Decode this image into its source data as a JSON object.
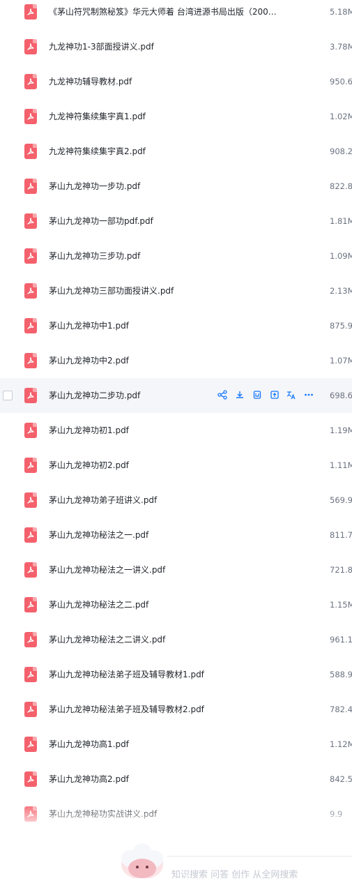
{
  "files": [
    {
      "name": "《茅山符咒制煞秘笈》华元大师着 台湾进源书局出版（200…",
      "size": "5.18M"
    },
    {
      "name": "九龙神功1-3部面授讲义.pdf",
      "size": "3.78M"
    },
    {
      "name": "九龙神功辅导教材.pdf",
      "size": "950.6"
    },
    {
      "name": "九龙神符集续集宇真1.pdf",
      "size": "1.02M"
    },
    {
      "name": "九龙神符集续集宇真2.pdf",
      "size": "908.2"
    },
    {
      "name": "茅山九龙神功一步功.pdf",
      "size": "822.8"
    },
    {
      "name": "茅山九龙神功一部功pdf.pdf",
      "size": "1.81M"
    },
    {
      "name": "茅山九龙神功三步功.pdf",
      "size": "1.09M"
    },
    {
      "name": "茅山九龙神功三部功面授讲义.pdf",
      "size": "2.13M"
    },
    {
      "name": "茅山九龙神功中1.pdf",
      "size": "875.9"
    },
    {
      "name": "茅山九龙神功中2.pdf",
      "size": "1.07M"
    },
    {
      "name": "茅山九龙神功二步功.pdf",
      "size": "698.6"
    },
    {
      "name": "茅山九龙神功初1.pdf",
      "size": "1.19M"
    },
    {
      "name": "茅山九龙神功初2.pdf",
      "size": "1.11M"
    },
    {
      "name": "茅山九龙神功弟子班讲义.pdf",
      "size": "569.9"
    },
    {
      "name": "茅山九龙神功秘法之一.pdf",
      "size": "811.7"
    },
    {
      "name": "茅山九龙神功秘法之一讲义.pdf",
      "size": "721.8"
    },
    {
      "name": "茅山九龙神功秘法之二.pdf",
      "size": "1.15M"
    },
    {
      "name": "茅山九龙神功秘法之二讲义.pdf",
      "size": "961.1"
    },
    {
      "name": "茅山九龙神功秘法弟子班及辅导教材1.pdf",
      "size": "588.9"
    },
    {
      "name": "茅山九龙神功秘法弟子班及辅导教材2.pdf",
      "size": "782.4"
    },
    {
      "name": "茅山九龙神功高1.pdf",
      "size": "1.12M"
    },
    {
      "name": "茅山九龙神功高2.pdf",
      "size": "842.5"
    },
    {
      "name": "茅山九龙神秘功实战讲义.pdf",
      "size": "9.9"
    }
  ],
  "hover_row_index": 11,
  "hover_actions": [
    "share-icon",
    "download-icon",
    "save-icon",
    "upload-icon",
    "translate-icon",
    "more-icon"
  ],
  "bottom": {
    "text": "知识搜索 问答 创作 从全网搜索"
  },
  "colors": {
    "pdf_icon": "#f4616c",
    "action": "#1677ff",
    "size_text": "#6b7280"
  }
}
